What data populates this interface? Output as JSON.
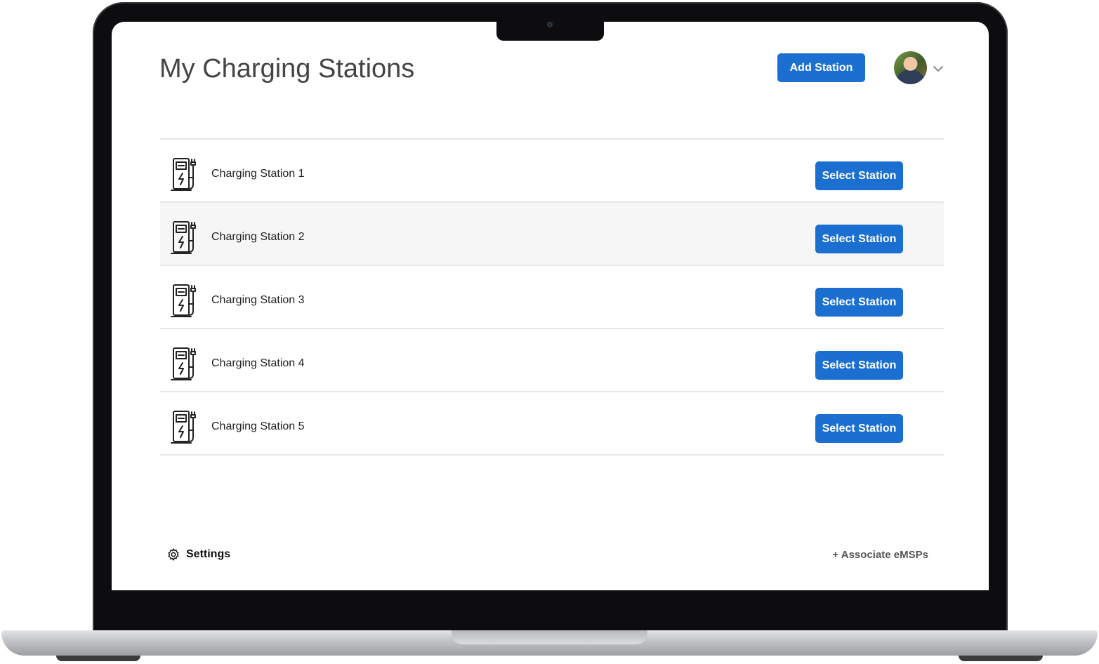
{
  "header": {
    "title": "My Charging Stations",
    "add_station_label": "Add Station",
    "avatar_icon": "user-avatar",
    "menu_icon": "chevron-down-icon"
  },
  "stations": [
    {
      "name": "Charging Station 1",
      "button_label": "Select Station",
      "icon": "ev-charger-icon"
    },
    {
      "name": "Charging Station 2",
      "button_label": "Select Station",
      "icon": "ev-charger-icon"
    },
    {
      "name": "Charging Station 3",
      "button_label": "Select Station",
      "icon": "ev-charger-icon"
    },
    {
      "name": "Charging Station 4",
      "button_label": "Select Station",
      "icon": "ev-charger-icon"
    },
    {
      "name": "Charging Station 5",
      "button_label": "Select Station",
      "icon": "ev-charger-icon"
    }
  ],
  "footer": {
    "settings_label": "Settings",
    "settings_icon": "gear-icon",
    "associate_label": "+ Associate eMSPs"
  },
  "colors": {
    "accent": "#1a6fd0",
    "highlight_row": "#f6f6f7",
    "divider": "#e6e6e8"
  }
}
